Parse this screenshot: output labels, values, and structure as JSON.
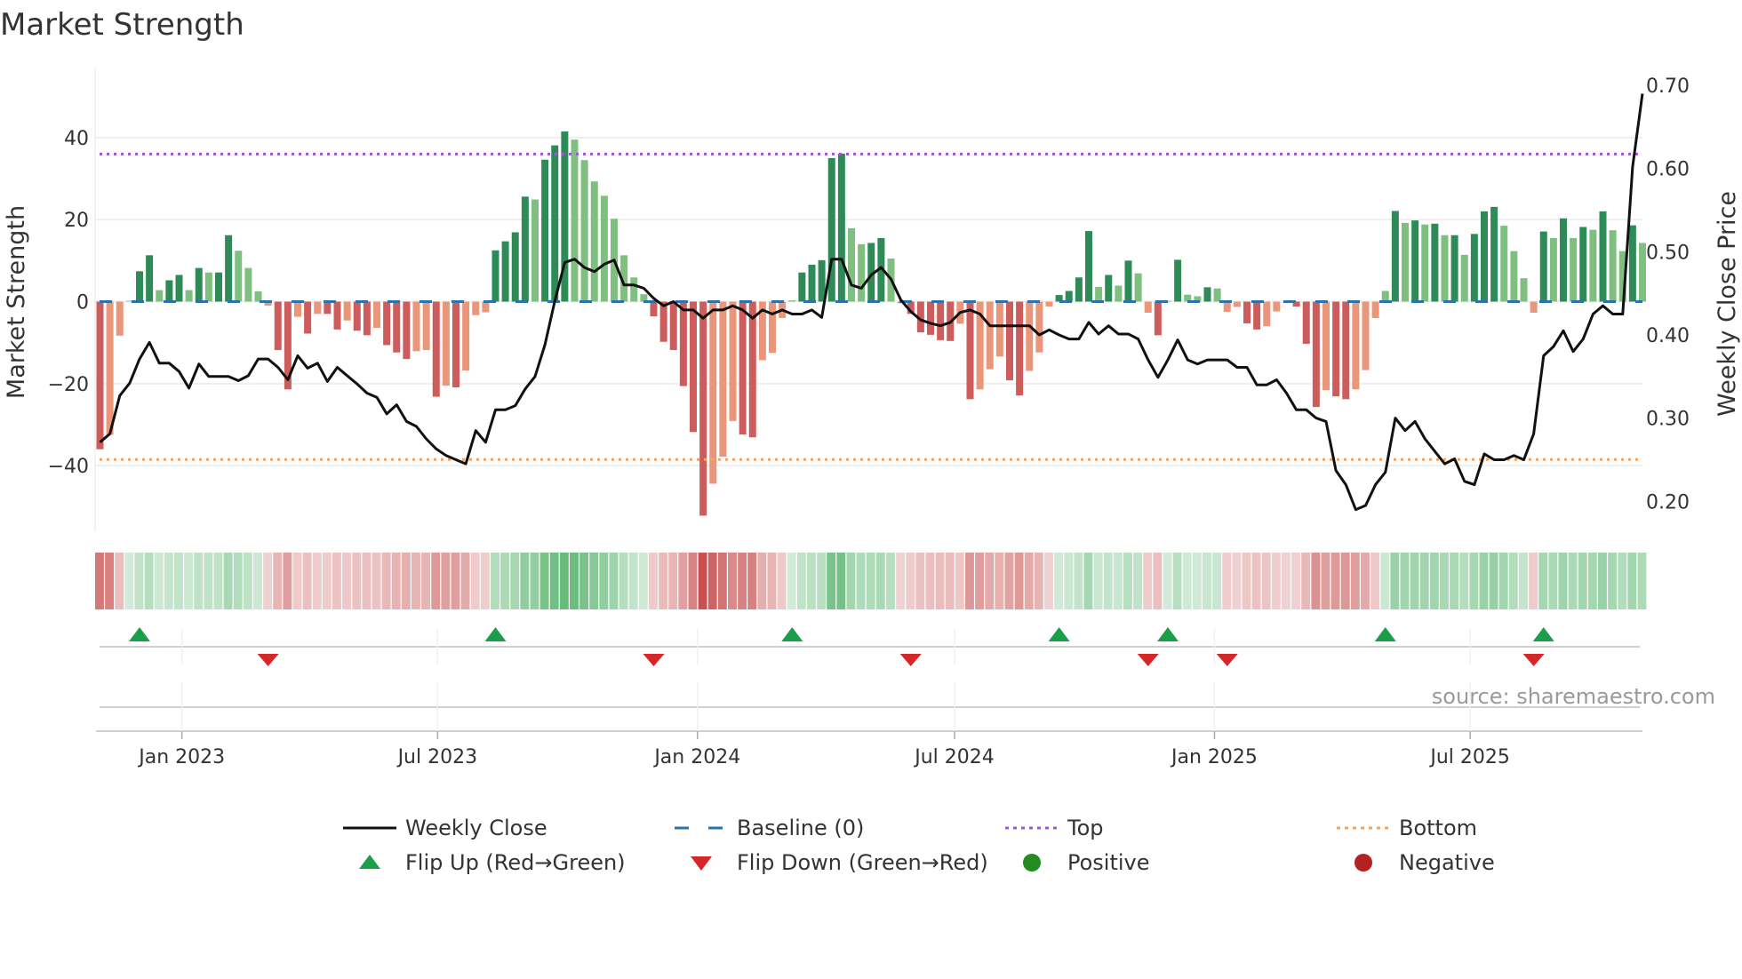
{
  "title": "Market Strength",
  "source": "source: sharemaestro.com",
  "chart_data": {
    "type": "bar",
    "title": "Market Strength",
    "ylabel": "Market Strength",
    "y2label": "Weekly Close Price",
    "start_date": "2022-11-04",
    "interval": "weekly",
    "ylim": [
      -56,
      56
    ],
    "y2lim": [
      0.164,
      0.716
    ],
    "yticks": [
      {
        "v": 40,
        "label": "40"
      },
      {
        "v": 20,
        "label": "20"
      },
      {
        "v": 0,
        "label": "0"
      },
      {
        "v": -20,
        "label": "−20"
      },
      {
        "v": -40,
        "label": "−40"
      }
    ],
    "y2ticks": [
      {
        "v": 0.7,
        "label": "0.70"
      },
      {
        "v": 0.6,
        "label": "0.60"
      },
      {
        "v": 0.5,
        "label": "0.50"
      },
      {
        "v": 0.4,
        "label": "0.40"
      },
      {
        "v": 0.3,
        "label": "0.30"
      },
      {
        "v": 0.2,
        "label": "0.20"
      }
    ],
    "xticks": [
      {
        "date": "2023-01-01",
        "label": "Jan 2023"
      },
      {
        "date": "2023-07-01",
        "label": "Jul 2023"
      },
      {
        "date": "2024-01-01",
        "label": "Jan 2024"
      },
      {
        "date": "2024-07-01",
        "label": "Jul 2024"
      },
      {
        "date": "2025-01-01",
        "label": "Jan 2025"
      },
      {
        "date": "2025-07-01",
        "label": "Jul 2025"
      }
    ],
    "top_level": 36,
    "bottom_level": -38.5,
    "strength": [
      -36,
      -32.5,
      -8.3,
      0.2,
      7.4,
      11.3,
      2.8,
      5.2,
      6.5,
      2.8,
      8.2,
      7.1,
      7.1,
      16.2,
      12.4,
      8.2,
      2.5,
      -1,
      -11.8,
      -21.4,
      -3.7,
      -7.8,
      -3,
      -3,
      -6.8,
      -4.6,
      -7.1,
      -8.2,
      -6.4,
      -10.6,
      -12.4,
      -14,
      -12.1,
      -11.8,
      -23.2,
      -20.5,
      -20.9,
      -16.8,
      -3.3,
      -2.6,
      12.5,
      14.7,
      16.9,
      25.6,
      24.9,
      34.6,
      38.1,
      41.5,
      39.5,
      34.5,
      29.3,
      25.8,
      20.2,
      11.3,
      5.9,
      1.8,
      -3.6,
      -9.8,
      -11.8,
      -20.6,
      -31.8,
      -52.2,
      -44.4,
      -37.8,
      -29.1,
      -32.4,
      -33.1,
      -14.3,
      -12.5,
      -4,
      0.3,
      7.1,
      9,
      10.1,
      35,
      36.1,
      17.9,
      14,
      14.3,
      15.5,
      10.5,
      -0.4,
      -3,
      -7.5,
      -8.1,
      -9.4,
      -9.6,
      -5.4,
      -23.8,
      -21.4,
      -16.5,
      -13.4,
      -19.2,
      -22.9,
      -16.9,
      -12.4,
      -1.2,
      1.6,
      2.6,
      5.9,
      17.2,
      3.6,
      6.5,
      3.9,
      10,
      6.9,
      -2.7,
      -8.2,
      0.2,
      10.2,
      1.7,
      1.3,
      3.5,
      3.2,
      -2.5,
      -1.3,
      -5.3,
      -6.8,
      -6,
      -2.4,
      -0.3,
      -1.2,
      -10.3,
      -25.7,
      -21.6,
      -23.1,
      -23.8,
      -21.4,
      -16.7,
      -4,
      2.6,
      22.1,
      19.2,
      19.8,
      18.8,
      19,
      16.2,
      16.2,
      11.4,
      16.5,
      22,
      23.1,
      18.5,
      12.3,
      5.7,
      -2.7,
      17.1,
      15.5,
      20.3,
      15.5,
      18.2,
      17.5,
      22,
      17.4,
      12.3,
      18.6,
      14.3
    ],
    "weekly_close": [
      0.271,
      0.281,
      0.327,
      0.342,
      0.371,
      0.391,
      0.366,
      0.366,
      0.356,
      0.336,
      0.365,
      0.35,
      0.35,
      0.35,
      0.345,
      0.351,
      0.371,
      0.371,
      0.361,
      0.346,
      0.375,
      0.36,
      0.366,
      0.344,
      0.361,
      0.351,
      0.341,
      0.33,
      0.325,
      0.305,
      0.316,
      0.296,
      0.29,
      0.275,
      0.263,
      0.255,
      0.25,
      0.245,
      0.285,
      0.271,
      0.31,
      0.31,
      0.315,
      0.335,
      0.35,
      0.388,
      0.441,
      0.487,
      0.491,
      0.481,
      0.476,
      0.485,
      0.49,
      0.46,
      0.46,
      0.456,
      0.444,
      0.435,
      0.44,
      0.43,
      0.43,
      0.42,
      0.43,
      0.43,
      0.435,
      0.43,
      0.42,
      0.43,
      0.425,
      0.43,
      0.425,
      0.425,
      0.43,
      0.421,
      0.491,
      0.491,
      0.46,
      0.456,
      0.472,
      0.481,
      0.467,
      0.442,
      0.428,
      0.418,
      0.414,
      0.411,
      0.415,
      0.427,
      0.43,
      0.425,
      0.411,
      0.411,
      0.411,
      0.411,
      0.411,
      0.4,
      0.406,
      0.4,
      0.395,
      0.395,
      0.415,
      0.401,
      0.411,
      0.401,
      0.401,
      0.395,
      0.37,
      0.349,
      0.37,
      0.394,
      0.37,
      0.365,
      0.37,
      0.37,
      0.37,
      0.361,
      0.361,
      0.34,
      0.34,
      0.346,
      0.33,
      0.31,
      0.31,
      0.3,
      0.296,
      0.237,
      0.22,
      0.19,
      0.195,
      0.22,
      0.235,
      0.3,
      0.285,
      0.296,
      0.275,
      0.26,
      0.245,
      0.251,
      0.224,
      0.22,
      0.257,
      0.25,
      0.25,
      0.255,
      0.25,
      0.281,
      0.375,
      0.386,
      0.405,
      0.38,
      0.395,
      0.425,
      0.435,
      0.425,
      0.425,
      0.602,
      0.69
    ],
    "flip_up": [
      4,
      40,
      70,
      97,
      108,
      130,
      146
    ],
    "flip_down": [
      17,
      56,
      82,
      106,
      114,
      145
    ],
    "legend": {
      "placement": "bottom",
      "items": [
        {
          "key": "close",
          "label": "Weekly Close"
        },
        {
          "key": "baseline",
          "label": "Baseline (0)"
        },
        {
          "key": "top",
          "label": "Top"
        },
        {
          "key": "bottom",
          "label": "Bottom"
        },
        {
          "key": "flipup",
          "label": "Flip Up (Red→Green)"
        },
        {
          "key": "flipdown",
          "label": "Flip Down (Green→Red)"
        },
        {
          "key": "positive",
          "label": "Positive"
        },
        {
          "key": "negative",
          "label": "Negative"
        }
      ]
    },
    "colors": {
      "pos_strong": "#2e8b57",
      "pos_weak": "#7fbf7f",
      "neg_strong": "#cd5c5c",
      "neg_weak": "#e9967a",
      "close": "#111111",
      "baseline": "#2b73a8",
      "top": "#9b59d6",
      "bottom": "#f4a460",
      "flip_up": "#1a9e4a",
      "flip_down": "#d62728",
      "positive": "#228b22",
      "negative": "#b22222"
    }
  }
}
